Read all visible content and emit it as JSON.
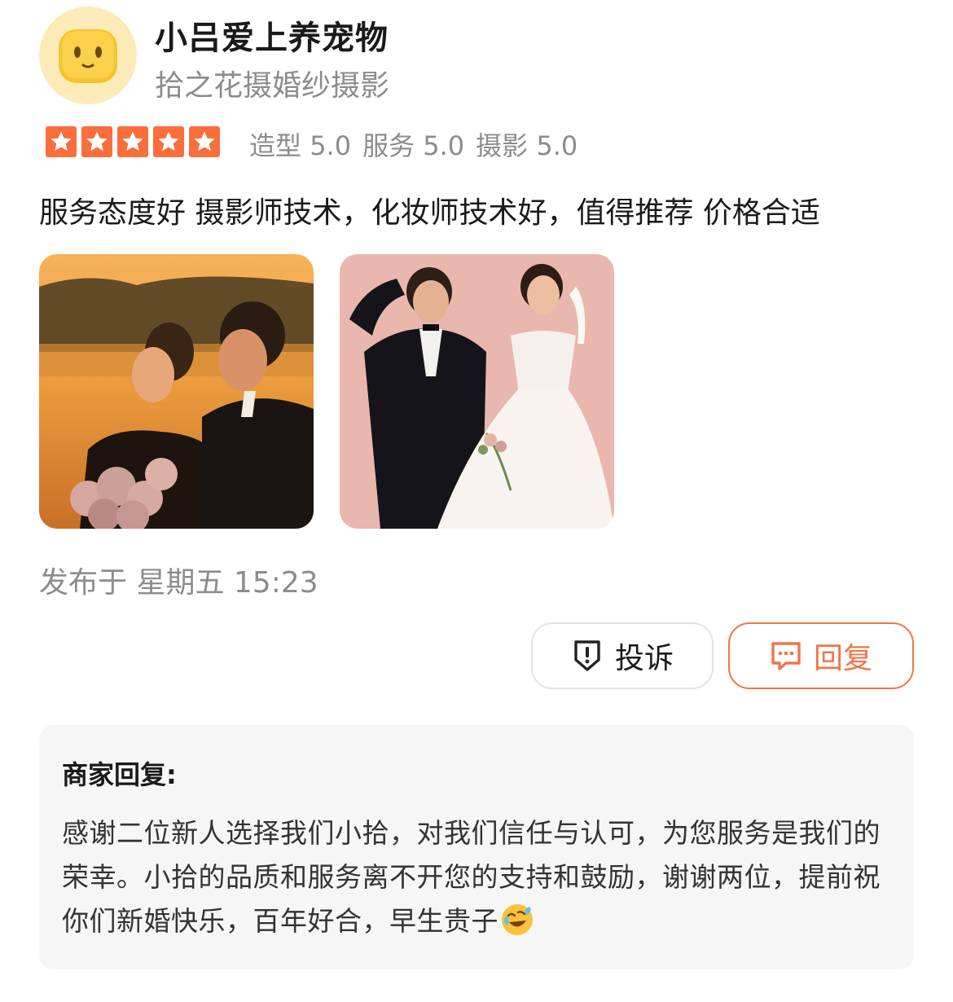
{
  "user": {
    "name": "小吕爱上养宠物",
    "shop": "拾之花摄婚纱摄影",
    "avatar_icon": "smiling-toast-icon",
    "avatar_color": "#fcebb9"
  },
  "rating": {
    "stars": 5,
    "star_color": "#fa6e3c",
    "items": [
      {
        "label": "造型",
        "score": "5.0"
      },
      {
        "label": "服务",
        "score": "5.0"
      },
      {
        "label": "摄影",
        "score": "5.0"
      }
    ]
  },
  "review": {
    "text": "服务态度好 摄影师技术，化妆师技术好，值得推荐 价格合适",
    "photos": [
      "sunset-couple-photo",
      "studio-couple-photo"
    ],
    "posted": "发布于 星期五 15:23"
  },
  "actions": {
    "report_label": "投诉",
    "report_icon": "shield-exclamation-icon",
    "reply_label": "回复",
    "reply_icon": "chat-bubble-icon",
    "accent_color": "#f07548"
  },
  "merchant_reply": {
    "title": "商家回复:",
    "text": "感谢二位新人选择我们小拾，对我们信任与认可，为您服务是我们的荣幸。小拾的品质和服务离不开您的支持和鼓励，谢谢两位，提前祝你们新婚快乐，百年好合，早生贵子",
    "emoji": "laughing-rolling-emoji"
  }
}
